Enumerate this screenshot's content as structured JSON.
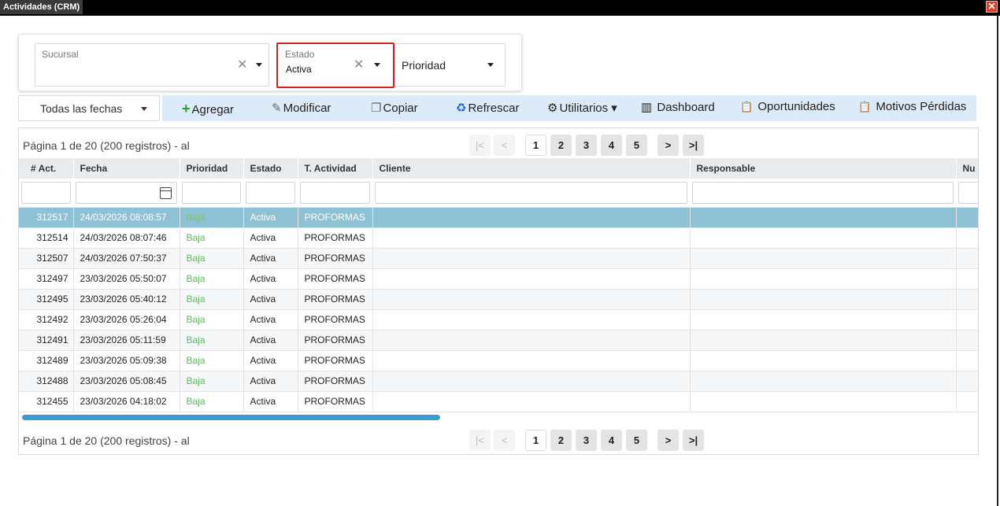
{
  "window": {
    "title": "Actividades (CRM)",
    "close_glyph": "✕"
  },
  "filters": {
    "sucursal": {
      "label": "Sucursal",
      "value": ""
    },
    "estado": {
      "label": "Estado",
      "value": "Activa"
    },
    "prioridad": {
      "value": "Prioridad"
    },
    "clear_glyph": "✕"
  },
  "date_filter": {
    "label": "Todas las fechas"
  },
  "toolbar": {
    "agregar": {
      "icon": "plus-icon",
      "glyph": "+",
      "label": "Agregar"
    },
    "modificar": {
      "icon": "pencil-icon",
      "glyph": "✎",
      "label": "Modificar"
    },
    "copiar": {
      "icon": "copy-icon",
      "glyph": "❐",
      "label": "Copiar"
    },
    "refrescar": {
      "icon": "recycle-icon",
      "glyph": "♻",
      "label": "Refrescar"
    },
    "utilitarios": {
      "icon": "gears-icon",
      "glyph": "⚙",
      "label": "Utilitarios ▾"
    },
    "dashboard": {
      "icon": "bar-chart-icon",
      "glyph": "▥",
      "label": "Dashboard"
    },
    "oportunidades": {
      "icon": "clipboard-icon",
      "glyph": "📋",
      "label": "Oportunidades"
    },
    "motivos": {
      "icon": "clipboard-icon",
      "glyph": "📋",
      "label": "Motivos Pérdidas"
    }
  },
  "pager": {
    "info": "Página 1 de 20 (200 registros) - al",
    "first": "|<",
    "prev": "<",
    "pages": [
      "1",
      "2",
      "3",
      "4",
      "5"
    ],
    "current": "1",
    "next": ">",
    "last": ">|"
  },
  "grid": {
    "columns": [
      "# Act.",
      "Fecha",
      "Prioridad",
      "Estado",
      "T. Actividad",
      "Cliente",
      "Responsable",
      "Nu"
    ],
    "rows": [
      {
        "id": "312517",
        "fecha": "24/03/2026 08:08:57",
        "prioridad": "Baja",
        "estado": "Activa",
        "tipo": "PROFORMAS",
        "cliente": "",
        "responsable": ""
      },
      {
        "id": "312514",
        "fecha": "24/03/2026 08:07:46",
        "prioridad": "Baja",
        "estado": "Activa",
        "tipo": "PROFORMAS",
        "cliente": "",
        "responsable": ""
      },
      {
        "id": "312507",
        "fecha": "24/03/2026 07:50:37",
        "prioridad": "Baja",
        "estado": "Activa",
        "tipo": "PROFORMAS",
        "cliente": "",
        "responsable": ""
      },
      {
        "id": "312497",
        "fecha": "23/03/2026 05:50:07",
        "prioridad": "Baja",
        "estado": "Activa",
        "tipo": "PROFORMAS",
        "cliente": "",
        "responsable": ""
      },
      {
        "id": "312495",
        "fecha": "23/03/2026 05:40:12",
        "prioridad": "Baja",
        "estado": "Activa",
        "tipo": "PROFORMAS",
        "cliente": "",
        "responsable": ""
      },
      {
        "id": "312492",
        "fecha": "23/03/2026 05:26:04",
        "prioridad": "Baja",
        "estado": "Activa",
        "tipo": "PROFORMAS",
        "cliente": "",
        "responsable": ""
      },
      {
        "id": "312491",
        "fecha": "23/03/2026 05:11:59",
        "prioridad": "Baja",
        "estado": "Activa",
        "tipo": "PROFORMAS",
        "cliente": "",
        "responsable": ""
      },
      {
        "id": "312489",
        "fecha": "23/03/2026 05:09:38",
        "prioridad": "Baja",
        "estado": "Activa",
        "tipo": "PROFORMAS",
        "cliente": "",
        "responsable": ""
      },
      {
        "id": "312488",
        "fecha": "23/03/2026 05:08:45",
        "prioridad": "Baja",
        "estado": "Activa",
        "tipo": "PROFORMAS",
        "cliente": "",
        "responsable": ""
      },
      {
        "id": "312455",
        "fecha": "23/03/2026 04:18:02",
        "prioridad": "Baja",
        "estado": "Activa",
        "tipo": "PROFORMAS",
        "cliente": "",
        "responsable": ""
      }
    ],
    "selected_row": 0
  },
  "colors": {
    "toolbar_bg": "#ddebf8",
    "selected_row": "#8fc1d4",
    "prioridad_baja": "#5cb85c",
    "highlight_border": "#d62020",
    "scrollbar": "#3a9bd5"
  }
}
